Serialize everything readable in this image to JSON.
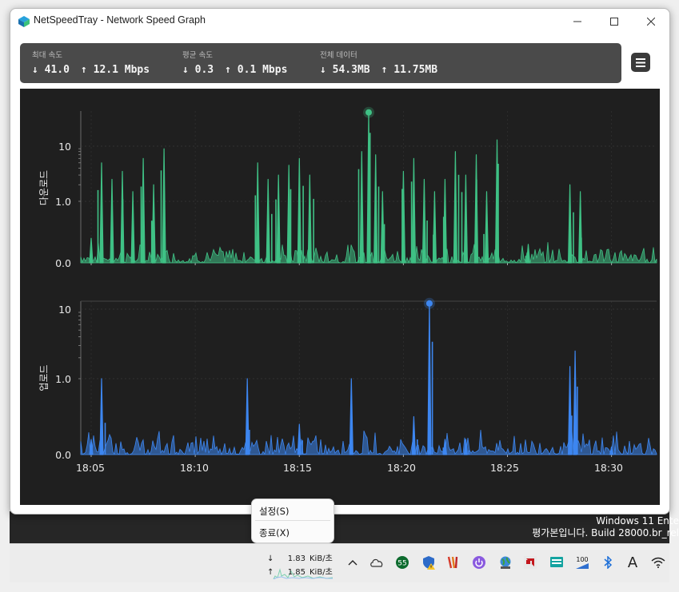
{
  "window": {
    "title": "NetSpeedTray - Network Speed Graph"
  },
  "stats": {
    "max": {
      "label": "최대 속도",
      "down": "↓ 41.0",
      "up": "↑ 12.1 Mbps"
    },
    "avg": {
      "label": "평균 속도",
      "down": "↓ 0.3",
      "up": "↑ 0.1 Mbps"
    },
    "total": {
      "label": "전체 데이터",
      "down": "↓ 54.3MB",
      "up": "↑ 11.75MB"
    }
  },
  "graph": {
    "download_axis_label": "다운로드",
    "upload_axis_label": "업로드",
    "download_ticks": [
      "10",
      "1.0",
      "0.0"
    ],
    "upload_ticks": [
      "10",
      "1.0",
      "0.0"
    ],
    "x_ticks": [
      "18:05",
      "18:10",
      "18:15",
      "18:20",
      "18:25",
      "18:30"
    ],
    "download_color": "#3fc185",
    "upload_color": "#3d86f0"
  },
  "chart_data": [
    {
      "type": "area",
      "series_role": "download",
      "scale": "log",
      "yticks": [
        "0.0",
        "1.0",
        "10"
      ],
      "x_range": [
        "18:04:30",
        "18:32:10"
      ],
      "x": [
        "18:05",
        "18:05:30",
        "18:06",
        "18:06:30",
        "18:07",
        "18:07:30",
        "18:08",
        "18:08:30",
        "18:13",
        "18:13:30",
        "18:14",
        "18:14:30",
        "18:15",
        "18:15:30",
        "18:18",
        "18:18:20",
        "18:18:40",
        "18:19",
        "18:20",
        "18:20:30",
        "18:21",
        "18:21:30",
        "18:22",
        "18:22:30",
        "18:23",
        "18:23:30",
        "18:24",
        "18:24:30",
        "18:26",
        "18:28",
        "18:28:30"
      ],
      "values": [
        0.4,
        5.0,
        2.5,
        3.5,
        1.5,
        6.0,
        2.0,
        9.0,
        5.0,
        2.5,
        3.0,
        4.5,
        6.0,
        3.0,
        8.0,
        41.0,
        7.0,
        1.5,
        3.5,
        6.0,
        2.5,
        1.5,
        2.5,
        8.0,
        3.0,
        7.0,
        1.5,
        13.0,
        0.3,
        2.0,
        1.5
      ]
    },
    {
      "type": "area",
      "series_role": "upload",
      "scale": "log",
      "yticks": [
        "0.0",
        "1.0",
        "10"
      ],
      "x_range": [
        "18:04:30",
        "18:32:10"
      ],
      "x": [
        "18:05",
        "18:05:30",
        "18:12:30",
        "18:15",
        "18:17:30",
        "18:20:30",
        "18:21:15",
        "18:22",
        "18:23",
        "18:28",
        "18:28:15",
        "18:30"
      ],
      "values": [
        0.2,
        1.0,
        1.0,
        0.4,
        1.0,
        0.5,
        12.1,
        0.2,
        0.2,
        1.5,
        2.5,
        0.1
      ]
    }
  ],
  "context_menu": {
    "settings": "설정(S)",
    "exit": "종료(X)"
  },
  "watermark": {
    "line1": "Windows 11 Ente",
    "line2": "평가본입니다. Build 28000.br_rel"
  },
  "tray": {
    "down_arrow": "↓",
    "down_value": "1.83",
    "down_unit": "KiB/초",
    "up_arrow": "↑",
    "up_value": "1.85",
    "up_unit": "KiB/초",
    "caret": "^",
    "badge_55": "55",
    "badge_100": "100",
    "ime": "A"
  }
}
